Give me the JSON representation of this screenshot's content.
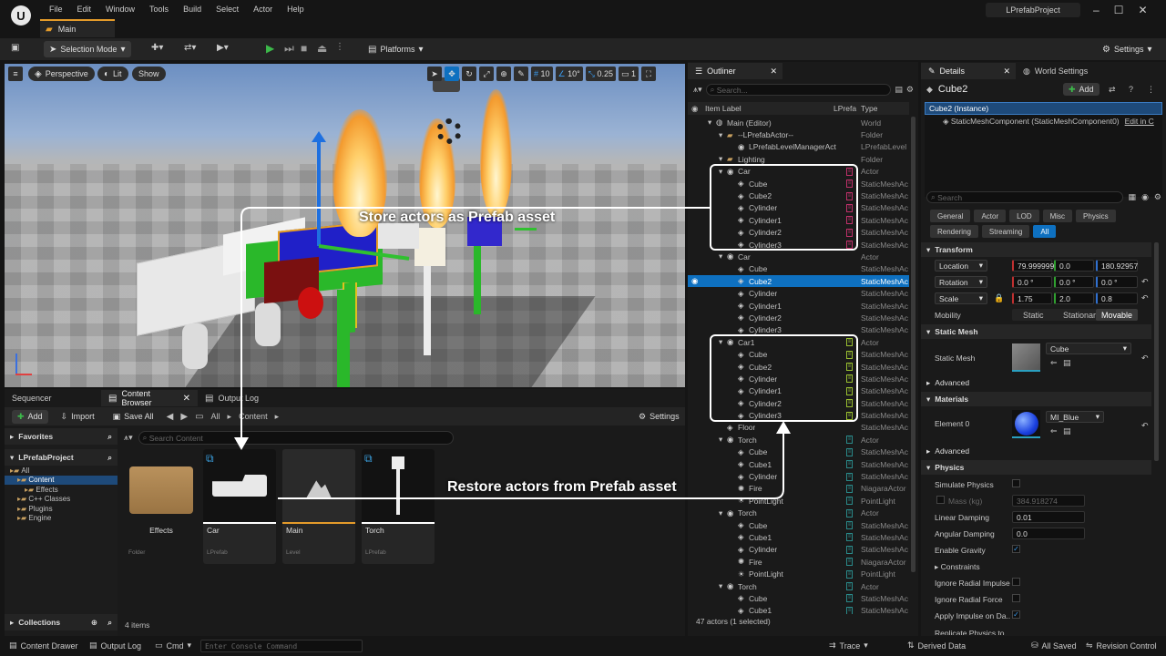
{
  "app": {
    "project": "LPrefabProject",
    "level_tab": "Main"
  },
  "menu": [
    "File",
    "Edit",
    "Window",
    "Tools",
    "Build",
    "Select",
    "Actor",
    "Help"
  ],
  "toolbar": {
    "selection_mode": "Selection Mode",
    "platforms": "Platforms",
    "settings": "Settings"
  },
  "viewport": {
    "perspective": "Perspective",
    "lit": "Lit",
    "show": "Show",
    "grid_snap": "10",
    "angle_snap": "10°",
    "scale_snap": "0.25",
    "camera_speed": "1"
  },
  "callouts": {
    "store": "Store actors as Prefab asset",
    "restore": "Restore actors from Prefab asset"
  },
  "bottom_tabs": [
    "Sequencer",
    "Content Browser",
    "Output Log"
  ],
  "content_browser": {
    "add": "Add",
    "import": "Import",
    "save_all": "Save All",
    "path": [
      "All",
      "Content"
    ],
    "settings": "Settings",
    "favorites": "Favorites",
    "project": "LPrefabProject",
    "tree": [
      {
        "label": "All",
        "indent": 0
      },
      {
        "label": "Content",
        "indent": 1,
        "selected": true
      },
      {
        "label": "Effects",
        "indent": 2
      },
      {
        "label": "C++ Classes",
        "indent": 1
      },
      {
        "label": "Plugins",
        "indent": 1
      },
      {
        "label": "Engine",
        "indent": 1
      }
    ],
    "search_placeholder": "Search Content",
    "collections": "Collections",
    "items_count": "4 items",
    "assets": [
      {
        "name": "Effects",
        "kind": "Folder",
        "bar": ""
      },
      {
        "name": "Car",
        "kind": "LPrefab",
        "bar": "#ffffff"
      },
      {
        "name": "Main",
        "kind": "Level",
        "bar": "#e49b2a"
      },
      {
        "name": "Torch",
        "kind": "LPrefab",
        "bar": "#ffffff"
      }
    ]
  },
  "outliner": {
    "title": "Outliner",
    "search_placeholder": "Search...",
    "col_label": "Item Label",
    "col_prefab": "LPrefa",
    "col_type": "Type",
    "footer": "47 actors (1 selected)",
    "rows": [
      {
        "label": "Main (Editor)",
        "type": "World",
        "indent": 1,
        "icon": "world"
      },
      {
        "label": "--LPrefabActor--",
        "type": "Folder",
        "indent": 2,
        "icon": "folder"
      },
      {
        "label": "LPrefabLevelManagerAct",
        "type": "LPrefabLevel",
        "indent": 3,
        "icon": "actor"
      },
      {
        "label": "Lighting",
        "type": "Folder",
        "indent": 2,
        "icon": "folder"
      },
      {
        "label": "Car",
        "type": "Actor",
        "indent": 2,
        "icon": "actor",
        "mark": "#c0306a"
      },
      {
        "label": "Cube",
        "type": "StaticMeshAc",
        "indent": 3,
        "icon": "mesh",
        "mark": "#c0306a"
      },
      {
        "label": "Cube2",
        "type": "StaticMeshAc",
        "indent": 3,
        "icon": "mesh",
        "mark": "#c0306a"
      },
      {
        "label": "Cylinder",
        "type": "StaticMeshAc",
        "indent": 3,
        "icon": "mesh",
        "mark": "#c0306a"
      },
      {
        "label": "Cylinder1",
        "type": "StaticMeshAc",
        "indent": 3,
        "icon": "mesh",
        "mark": "#c0306a"
      },
      {
        "label": "Cylinder2",
        "type": "StaticMeshAc",
        "indent": 3,
        "icon": "mesh",
        "mark": "#c0306a"
      },
      {
        "label": "Cylinder3",
        "type": "StaticMeshAc",
        "indent": 3,
        "icon": "mesh",
        "mark": "#c0306a"
      },
      {
        "label": "Car",
        "type": "Actor",
        "indent": 2,
        "icon": "actor"
      },
      {
        "label": "Cube",
        "type": "StaticMeshAc",
        "indent": 3,
        "icon": "mesh"
      },
      {
        "label": "Cube2",
        "type": "StaticMeshAc",
        "indent": 3,
        "icon": "mesh",
        "selected": true
      },
      {
        "label": "Cylinder",
        "type": "StaticMeshAc",
        "indent": 3,
        "icon": "mesh"
      },
      {
        "label": "Cylinder1",
        "type": "StaticMeshAc",
        "indent": 3,
        "icon": "mesh"
      },
      {
        "label": "Cylinder2",
        "type": "StaticMeshAc",
        "indent": 3,
        "icon": "mesh"
      },
      {
        "label": "Cylinder3",
        "type": "StaticMeshAc",
        "indent": 3,
        "icon": "mesh"
      },
      {
        "label": "Car1",
        "type": "Actor",
        "indent": 2,
        "icon": "actor",
        "mark": "#9ac030"
      },
      {
        "label": "Cube",
        "type": "StaticMeshAc",
        "indent": 3,
        "icon": "mesh",
        "mark": "#9ac030"
      },
      {
        "label": "Cube2",
        "type": "StaticMeshAc",
        "indent": 3,
        "icon": "mesh",
        "mark": "#9ac030"
      },
      {
        "label": "Cylinder",
        "type": "StaticMeshAc",
        "indent": 3,
        "icon": "mesh",
        "mark": "#9ac030"
      },
      {
        "label": "Cylinder1",
        "type": "StaticMeshAc",
        "indent": 3,
        "icon": "mesh",
        "mark": "#9ac030"
      },
      {
        "label": "Cylinder2",
        "type": "StaticMeshAc",
        "indent": 3,
        "icon": "mesh",
        "mark": "#9ac030"
      },
      {
        "label": "Cylinder3",
        "type": "StaticMeshAc",
        "indent": 3,
        "icon": "mesh",
        "mark": "#9ac030"
      },
      {
        "label": "Floor",
        "type": "StaticMeshAc",
        "indent": 2,
        "icon": "mesh"
      },
      {
        "label": "Torch",
        "type": "Actor",
        "indent": 2,
        "icon": "actor",
        "mark": "#2a8a8a"
      },
      {
        "label": "Cube",
        "type": "StaticMeshAc",
        "indent": 3,
        "icon": "mesh",
        "mark": "#2a8a8a"
      },
      {
        "label": "Cube1",
        "type": "StaticMeshAc",
        "indent": 3,
        "icon": "mesh",
        "mark": "#2a8a8a"
      },
      {
        "label": "Cylinder",
        "type": "StaticMeshAc",
        "indent": 3,
        "icon": "mesh",
        "mark": "#2a8a8a"
      },
      {
        "label": "Fire",
        "type": "NiagaraActor",
        "indent": 3,
        "icon": "fire",
        "mark": "#2a8a8a"
      },
      {
        "label": "PointLight",
        "type": "PointLight",
        "indent": 3,
        "icon": "light",
        "mark": "#2a8a8a"
      },
      {
        "label": "Torch",
        "type": "Actor",
        "indent": 2,
        "icon": "actor",
        "mark": "#2a8a8a"
      },
      {
        "label": "Cube",
        "type": "StaticMeshAc",
        "indent": 3,
        "icon": "mesh",
        "mark": "#2a8a8a"
      },
      {
        "label": "Cube1",
        "type": "StaticMeshAc",
        "indent": 3,
        "icon": "mesh",
        "mark": "#2a8a8a"
      },
      {
        "label": "Cylinder",
        "type": "StaticMeshAc",
        "indent": 3,
        "icon": "mesh",
        "mark": "#2a8a8a"
      },
      {
        "label": "Fire",
        "type": "NiagaraActor",
        "indent": 3,
        "icon": "fire",
        "mark": "#2a8a8a"
      },
      {
        "label": "PointLight",
        "type": "PointLight",
        "indent": 3,
        "icon": "light",
        "mark": "#2a8a8a"
      },
      {
        "label": "Torch",
        "type": "Actor",
        "indent": 2,
        "icon": "actor",
        "mark": "#2a8a8a"
      },
      {
        "label": "Cube",
        "type": "StaticMeshAc",
        "indent": 3,
        "icon": "mesh",
        "mark": "#2a8a8a"
      },
      {
        "label": "Cube1",
        "type": "StaticMeshAc",
        "indent": 3,
        "icon": "mesh",
        "mark": "#2a8a8a"
      }
    ]
  },
  "details": {
    "tab": "Details",
    "world_settings": "World Settings",
    "object": "Cube2",
    "add": "Add",
    "instance": "Cube2 (Instance)",
    "component": "StaticMeshComponent (StaticMeshComponent0)",
    "edit_in": "Edit in C",
    "search_placeholder": "Search",
    "filters": [
      "General",
      "Actor",
      "LOD",
      "Misc",
      "Physics",
      "Rendering",
      "Streaming",
      "All"
    ],
    "transform": {
      "header": "Transform",
      "location": {
        "label": "Location",
        "x": "79.999999",
        "y": "0.0",
        "z": "180.92957"
      },
      "rotation": {
        "label": "Rotation",
        "x": "0.0 °",
        "y": "0.0 °",
        "z": "0.0 °"
      },
      "scale": {
        "label": "Scale",
        "x": "1.75",
        "y": "2.0",
        "z": "0.8"
      },
      "mobility": {
        "label": "Mobility",
        "options": [
          "Static",
          "Stationary",
          "Movable"
        ],
        "selected": "Movable"
      }
    },
    "static_mesh": {
      "header": "Static Mesh",
      "label": "Static Mesh",
      "value": "Cube"
    },
    "advanced": "Advanced",
    "materials": {
      "header": "Materials",
      "element": "Element 0",
      "value": "MI_Blue"
    },
    "physics": {
      "header": "Physics",
      "simulate": "Simulate Physics",
      "mass_label": "Mass (kg)",
      "mass": "384.918274",
      "linear_label": "Linear Damping",
      "linear": "0.01",
      "angular_label": "Angular Damping",
      "angular": "0.0",
      "gravity": "Enable Gravity",
      "constraints": "Constraints",
      "radial_impulse": "Ignore Radial Impulse",
      "radial_force": "Ignore Radial Force",
      "apply_impulse": "Apply Impulse on Da..",
      "replicate": "Replicate Physics to..."
    }
  },
  "statusbar": {
    "content_drawer": "Content Drawer",
    "output_log": "Output Log",
    "cmd": "Cmd",
    "console_placeholder": "Enter Console Command",
    "trace": "Trace",
    "derived": "Derived Data",
    "saved": "All Saved",
    "revision": "Revision Control"
  }
}
